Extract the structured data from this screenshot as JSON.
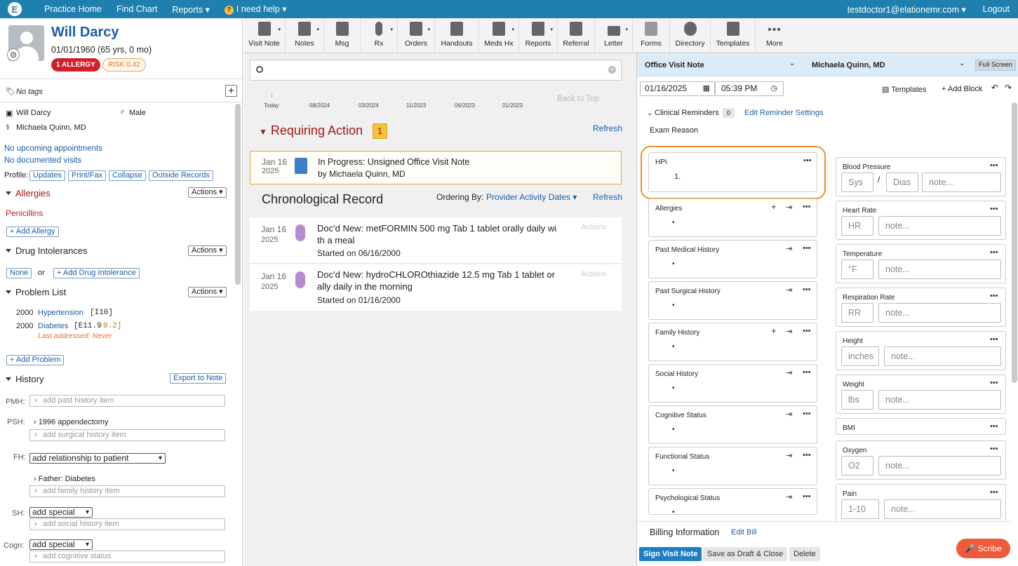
{
  "topnav": {
    "links": [
      "Practice Home",
      "Find Chart",
      "Reports ▾",
      "I need help ▾"
    ],
    "user": "testdoctor1@elationemr.com ▾",
    "logout": "Logout"
  },
  "patient": {
    "name": "Will Darcy",
    "dob": "01/01/1960 (65 yrs, 0 mo)",
    "allergy_badge": "1 ALLERGY",
    "risk_badge": "RISK 0.42",
    "tags": "No tags",
    "sex": "Male",
    "provider": "Michaela Quinn, MD",
    "appointments": "No upcoming appointments",
    "visits": "No documented visits"
  },
  "profile": {
    "label": "Profile:",
    "buttons": [
      "Updates",
      "Print/Fax",
      "Collapse",
      "Outside Records"
    ]
  },
  "allergies": {
    "title": "Allergies",
    "actions": "Actions ▾",
    "item": "Penicillins",
    "add": "+ Add Allergy"
  },
  "intolerances": {
    "title": "Drug Intolerances",
    "actions": "Actions ▾",
    "none": "None",
    "or": "or",
    "add": "+ Add Drug Intolerance"
  },
  "problems": {
    "title": "Problem List",
    "actions": "Actions ▾",
    "items": [
      {
        "year": "2000",
        "name": "Hypertension",
        "code": "[I10]"
      },
      {
        "year": "2000",
        "name": "Diabetes",
        "code": "[E11.9",
        "code2": "0.2]"
      }
    ],
    "last": "Last addressed: Never",
    "add": "+ Add Problem"
  },
  "history": {
    "title": "History",
    "export": "Export to Note",
    "pmh": "PMH:",
    "pmh_ph": "add past history item",
    "psh": "PSH:",
    "psh_item": "1996 appendectomy",
    "psh_ph": "add surgical history item",
    "fh": "FH:",
    "fh_sel": "add relationship to patient",
    "fh_item": "Father: Diabetes",
    "fh_ph": "add family history item",
    "sh": "SH:",
    "sh_sel": "add special",
    "sh_ph": "add social history item",
    "cogn": "Cogn:",
    "cogn_sel": "add special",
    "cogn_ph": "add cognitive status"
  },
  "toolbar": [
    "Visit Note",
    "Notes",
    "Msg",
    "Rx",
    "Orders",
    "Handouts",
    "Meds Hx",
    "Reports",
    "Referral",
    "Letter",
    "Forms",
    "Directory",
    "Templates",
    "More"
  ],
  "timeline": {
    "labels": [
      "Today",
      "08/2024",
      "03/2024",
      "11/2023",
      "06/2023",
      "01/2023"
    ],
    "back": "Back to Top"
  },
  "requiring": {
    "title": "Requiring Action",
    "count": "1",
    "refresh": "Refresh",
    "date": "Jan 16",
    "year": "2025",
    "line1": "In Progress: Unsigned Office Visit Note",
    "line2": "by Michaela Quinn, MD"
  },
  "chrono": {
    "title": "Chronological Record",
    "ordering": "Ordering By:",
    "ordering_val": "Provider Activity Dates ▾",
    "refresh": "Refresh",
    "items": [
      {
        "date": "Jan 16",
        "year": "2025",
        "l1": "Doc'd New: metFORMIN 500 mg Tab 1 tablet orally daily wi",
        "l2": "th a meal",
        "l3": "Started on 06/16/2000",
        "actions": "Actions"
      },
      {
        "date": "Jan 16",
        "year": "2025",
        "l1": "Doc'd New: hydroCHLOROthiazide 12.5 mg Tab 1 tablet or",
        "l2": "ally daily in the morning",
        "l3": "Started on 01/16/2000",
        "actions": "Actions"
      }
    ]
  },
  "note": {
    "type": "Office Visit Note",
    "provider": "Michaela Quinn, MD",
    "fullscreen": "Full Screen",
    "date": "01/16/2025",
    "time": "05:39 PM",
    "templates": "Templates",
    "addblock": "+ Add Block",
    "reminders": "Clinical Reminders",
    "rem_count": "0",
    "rem_settings": "Edit Reminder Settings",
    "exam": "Exam Reason",
    "hpi": "HPI",
    "hpi_item": "1.",
    "blocks": [
      "Allergies",
      "Past Medical History",
      "Past Surgical History",
      "Family History",
      "Social History",
      "Cognitive Status",
      "Functional Status",
      "Psychological Status"
    ],
    "vitals": [
      {
        "t": "Blood Pressure",
        "a": "Sys",
        "b": "Dias",
        "c": "note..."
      },
      {
        "t": "Heart Rate",
        "a": "HR",
        "c": "note..."
      },
      {
        "t": "Temperature",
        "a": "°F",
        "c": "note..."
      },
      {
        "t": "Respiration Rate",
        "a": "RR",
        "c": "note..."
      },
      {
        "t": "Height",
        "a": "inches",
        "c": "note..."
      },
      {
        "t": "Weight",
        "a": "lbs",
        "c": "note..."
      },
      {
        "t": "BMI"
      },
      {
        "t": "Oxygen",
        "a": "O2",
        "c": "note..."
      },
      {
        "t": "Pain",
        "a": "1-10",
        "c": "note..."
      }
    ],
    "billing": "Billing Information",
    "editbill": "Edit Bill",
    "sign": "Sign Visit Note",
    "draft": "Save as Draft & Close",
    "delete": "Delete",
    "scribe": "Scribe"
  }
}
